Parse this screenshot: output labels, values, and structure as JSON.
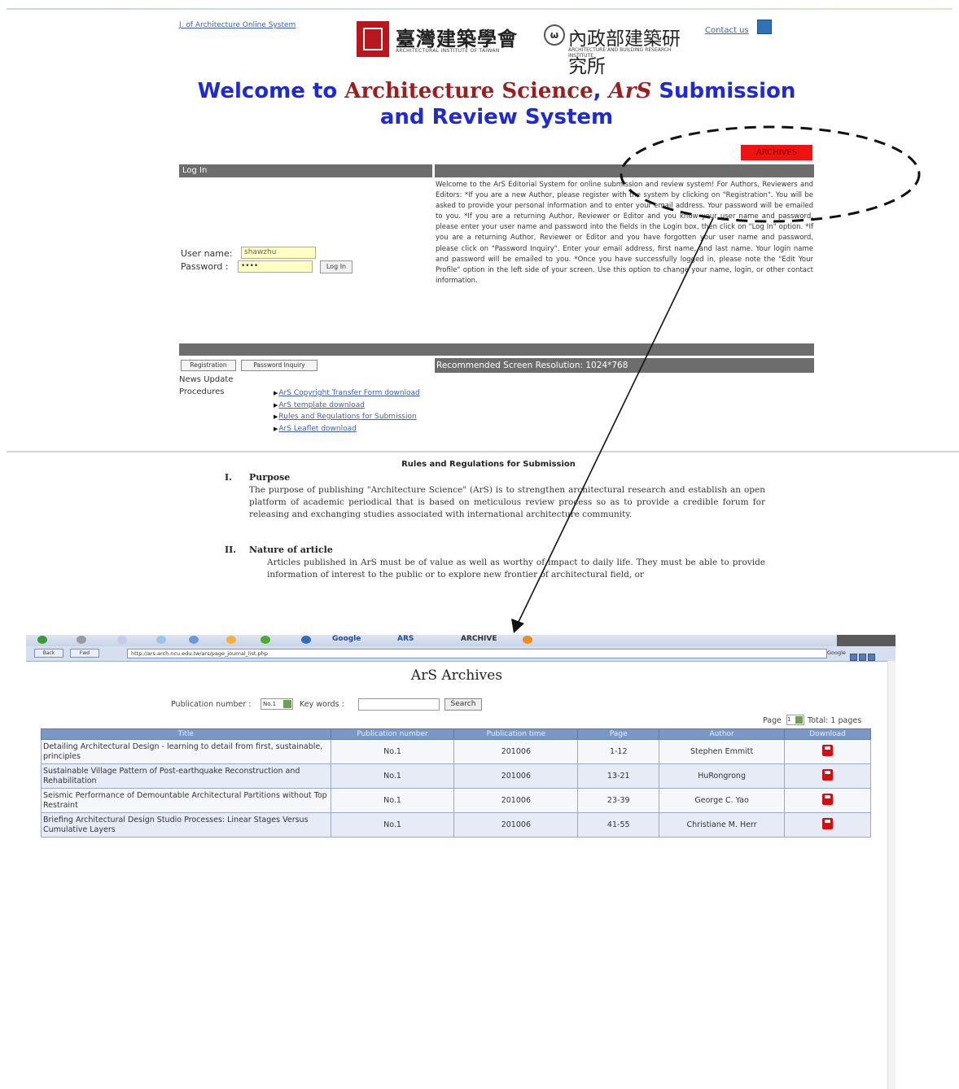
{
  "header": {
    "system_link": "J. of Architecture Online System",
    "logo1_cn": "臺灣建築學會",
    "logo1_en": "ARCHITECTURAL INSTITUTE OF TAIWAN",
    "logo2_cn": "內政部建築研究所",
    "logo2_en": "ARCHITECTURE AND BUILDING RESEARCH INSTITUTE",
    "contact": "Contact us"
  },
  "welcome": {
    "w1": "Welcome to ",
    "w2": "Architecture Science",
    "w3": ", ",
    "w4": "ArS",
    "w5": " Submission and Review System"
  },
  "archives_button": "ARCHIVES",
  "login": {
    "bar_label": "Log In",
    "username_label": "User name:",
    "username_value": "shawzhu",
    "password_label": "Password :",
    "password_value": "••••",
    "login_button": "Log In",
    "registration_button": "Registration",
    "password_inquiry_button": "Password Inquiry"
  },
  "info_text": "Welcome to the ArS Editorial System for online submission and review system! For Authors, Reviewers and Editors: *If you are a new Author, please register with the system by clicking on \"Registration\". You will be asked to provide your personal information and to enter your email address. Your password will be emailed to you. *If you are a returning Author, Reviewer or Editor and you know your user name and password, please enter your user name and password into the fields in the Login box, then click on \"Log In\" option. *If you are a returning Author, Reviewer or Editor and you have forgotten your user name and password, please click on \"Password Inquiry\". Enter your email address, first name, and last name. Your login name and password will be emailed to you. *Once you have successfully logged in, please note the \"Edit Your Profile\" option in the left side of your screen. Use this option to change your name, login, or other contact information.",
  "resolution_note": "Recommended Screen Resolution: 1024*768",
  "news_update": "News Update",
  "procedures": "Procedures",
  "procedure_links": [
    "ArS Copyright Transfer Form download",
    "ArS template download",
    "Rules and Regulations for Submission",
    "ArS Leaflet download"
  ],
  "rules": {
    "title": "Rules and Regulations for Submission",
    "s1_num": "I.",
    "s1_heading": "Purpose",
    "s1_text": "The purpose of publishing \"Architecture Science\" (ArS) is to strengthen architectural research and establish an open platform of academic periodical that is based on meticulous review process so as to provide a credible forum for releasing and exchanging studies associated with international architecture community.",
    "s2_num": "II.",
    "s2_heading": "Nature of article",
    "s2_text": "Articles published in ArS must be of value as well as worthy of impact to daily life. They must be able to provide information of interest to the public or to explore new frontier of architectural field, or"
  },
  "browser": {
    "toolbar_words": [
      "Google",
      "ARS",
      "ARCHIVE"
    ],
    "nav_back": "Back",
    "nav_fwd": "Fwd",
    "address": "http://ars.arch.ncu.edu.tw/ars/page_journal_list.php",
    "google_label": "Google",
    "title": "ArS Archives",
    "pub_number_label": "Publication number :",
    "pub_number_value": "No.1",
    "keywords_label": "Key words :",
    "search_button": "Search",
    "page_label": "Page",
    "page_value": "1",
    "total_label": "Total: 1 pages",
    "columns": [
      "Title",
      "Publication number",
      "Publication time",
      "Page",
      "Author",
      "Download"
    ],
    "rows": [
      {
        "title": "Detailing Architectural Design - learning to detail from first, sustainable, principles",
        "number": "No.1",
        "time": "201006",
        "page": "1-12",
        "author": "Stephen Emmitt"
      },
      {
        "title": "Sustainable Village Pattern of Post-earthquake Reconstruction and Rehabilitation",
        "number": "No.1",
        "time": "201006",
        "page": "13-21",
        "author": "HuRongrong"
      },
      {
        "title": "Seismic Performance of Demountable Architectural Partitions without Top Restraint",
        "number": "No.1",
        "time": "201006",
        "page": "23-39",
        "author": "George C. Yao"
      },
      {
        "title": "Briefing Architectural Design Studio Processes: Linear Stages Versus Cumulative Layers",
        "number": "No.1",
        "time": "201006",
        "page": "41-55",
        "author": "Christiane M. Herr"
      }
    ]
  },
  "colors": {
    "welcome_blue": "#1f2ad6",
    "serif_red": "#9b1f1f",
    "archives_red": "#ee1212",
    "bar_gray": "#6d6d6d",
    "table_header": "#7a98c6"
  }
}
